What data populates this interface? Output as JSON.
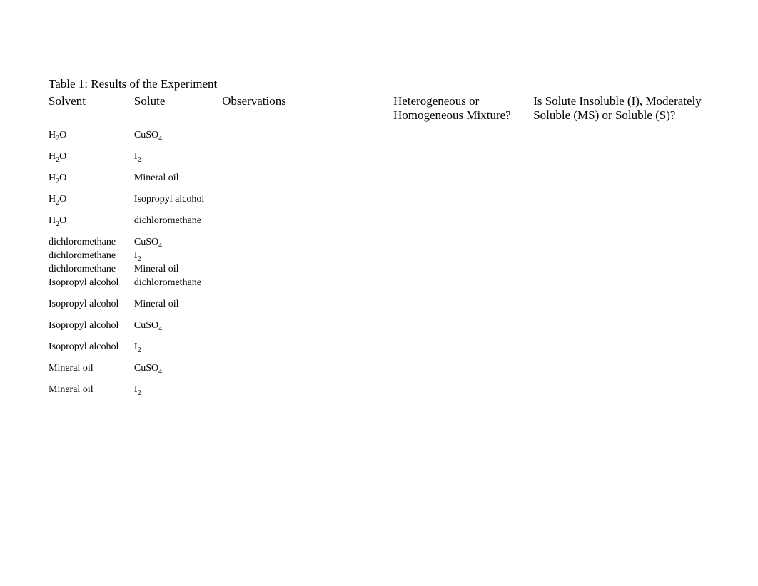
{
  "caption": "Table 1:  Results of the Experiment",
  "headers": {
    "solvent": "Solvent",
    "solute": "Solute",
    "observations": "Observations",
    "mixture": "Heterogeneous or Homogeneous Mixture?",
    "solubility": "Is Solute Insoluble (I), Moderately Soluble (MS) or Soluble (S)?"
  },
  "rows": [
    {
      "solvent_html": "H<sub>2</sub>O",
      "solute_html": "CuSO<sub>4</sub>",
      "observations": "",
      "mixture": "",
      "solubility": "",
      "tight": false
    },
    {
      "solvent_html": "H<sub>2</sub>O",
      "solute_html": "I<sub>2</sub>",
      "observations": "",
      "mixture": "",
      "solubility": "",
      "tight": false
    },
    {
      "solvent_html": "H<sub>2</sub>O",
      "solute_html": "Mineral oil",
      "observations": "",
      "mixture": "",
      "solubility": "",
      "tight": false
    },
    {
      "solvent_html": "H<sub>2</sub>O",
      "solute_html": "Isopropyl alcohol",
      "observations": "",
      "mixture": "",
      "solubility": "",
      "tight": false
    },
    {
      "solvent_html": "H<sub>2</sub>O",
      "solute_html": "dichloromethane",
      "observations": "",
      "mixture": "",
      "solubility": "",
      "tight": false
    },
    {
      "solvent_html": "dichloromethane",
      "solute_html": "CuSO<sub>4</sub>",
      "observations": "",
      "mixture": "",
      "solubility": "",
      "tight": true
    },
    {
      "solvent_html": "dichloromethane",
      "solute_html": "I<sub>2</sub>",
      "observations": "",
      "mixture": "",
      "solubility": "",
      "tight": true
    },
    {
      "solvent_html": "dichloromethane",
      "solute_html": "Mineral oil",
      "observations": "",
      "mixture": "",
      "solubility": "",
      "tight": true
    },
    {
      "solvent_html": "Isopropyl alcohol",
      "solute_html": "dichloromethane",
      "observations": "",
      "mixture": "",
      "solubility": "",
      "tight": false
    },
    {
      "solvent_html": "Isopropyl alcohol",
      "solute_html": "Mineral oil",
      "observations": "",
      "mixture": "",
      "solubility": "",
      "tight": false
    },
    {
      "solvent_html": "Isopropyl alcohol",
      "solute_html": "CuSO<sub>4</sub>",
      "observations": "",
      "mixture": "",
      "solubility": "",
      "tight": false
    },
    {
      "solvent_html": "Isopropyl alcohol",
      "solute_html": "I<sub>2</sub>",
      "observations": "",
      "mixture": "",
      "solubility": "",
      "tight": false
    },
    {
      "solvent_html": "Mineral oil",
      "solute_html": "CuSO<sub>4</sub>",
      "observations": "",
      "mixture": "",
      "solubility": "",
      "tight": false
    },
    {
      "solvent_html": "Mineral oil",
      "solute_html": "I<sub>2</sub>",
      "observations": "",
      "mixture": "",
      "solubility": "",
      "tight": false
    }
  ]
}
